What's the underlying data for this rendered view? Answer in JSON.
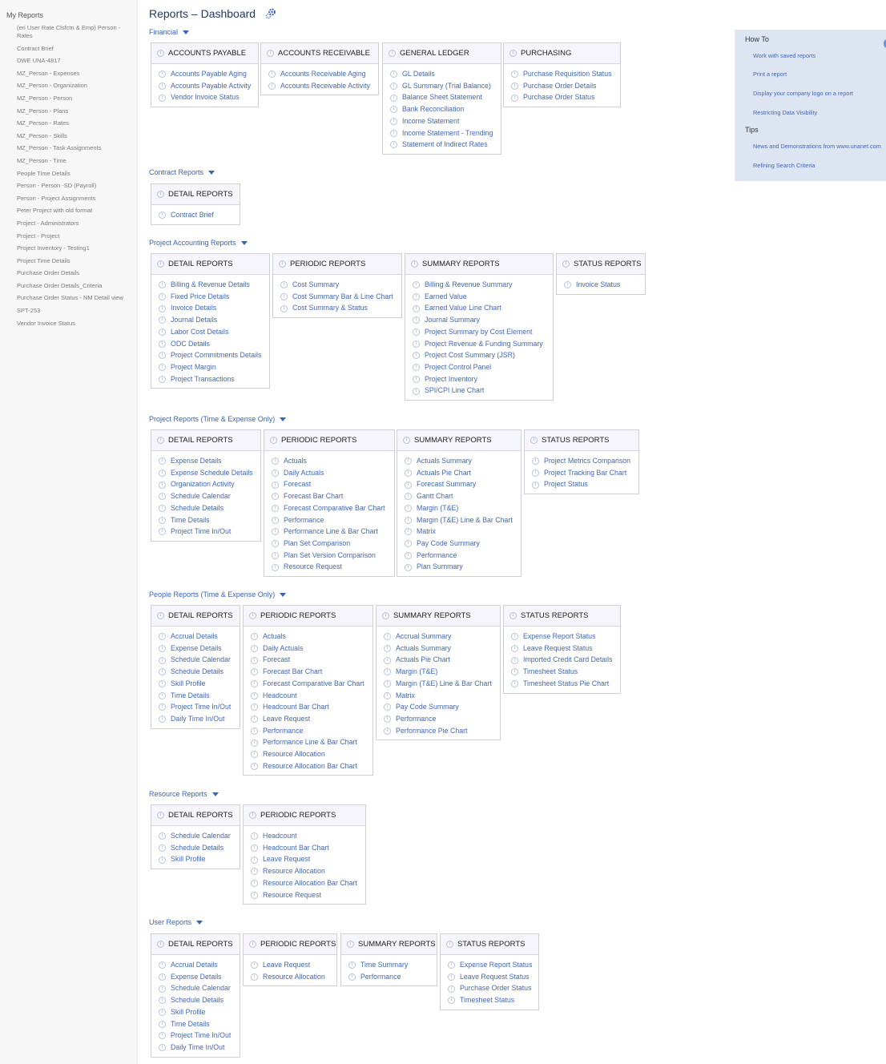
{
  "sidebar": {
    "title": "My Reports",
    "items": [
      "(eri User Rate Clsfctn & Emp) Person - Rates",
      "Contract Brief",
      "DWE UNA-4817",
      "MZ_Person - Expenses",
      "MZ_Person - Organization",
      "MZ_Person - Person",
      "MZ_Person - Plans",
      "MZ_Person - Rates",
      "MZ_Person - Skills",
      "MZ_Person - Task Assignments",
      "MZ_Person - Time",
      "People Time Details",
      "Person - Person -SD (Payroll)",
      "Person - Project Assignments",
      "Peter Project with old format",
      "Project - Administrators",
      "Project - Project",
      "Project Inventory - Testing1",
      "Project Time Details",
      "Purchase Order Details",
      "Purchase Order Details_Criteria",
      "Purchase Order Status - NM Detail view",
      "SPT-253",
      "Vendor Invoice Status"
    ]
  },
  "page_title": "Reports – Dashboard",
  "help": {
    "how_to_title": "How To",
    "how_to_links": [
      "Work with saved reports",
      "Print a report",
      "Display your company logo on a report",
      "Restricting Data Visibility"
    ],
    "tips_title": "Tips",
    "tips_links": [
      "News and Demonstrations from www.unanet.com",
      "Refining Search Criteria"
    ]
  },
  "sections": [
    {
      "title": "Financial",
      "boxes": [
        {
          "title": "ACCOUNTS PAYABLE",
          "items": [
            "Accounts Payable Aging",
            "Accounts Payable Activity",
            "Vendor Invoice Status"
          ]
        },
        {
          "title": "ACCOUNTS RECEIVABLE",
          "items": [
            "Accounts Receivable Aging",
            "Accounts Receivable Activity"
          ]
        },
        {
          "title": "GENERAL LEDGER",
          "items": [
            "GL Details",
            "GL Summary (Trial Balance)",
            "Balance Sheet Statement",
            "Bank Reconciliation",
            "Income Statement",
            "Income Statement - Trending",
            "Statement of Indirect Rates"
          ]
        },
        {
          "title": "PURCHASING",
          "items": [
            "Purchase Requisition Status",
            "Purchase Order Details",
            "Purchase Order Status"
          ]
        }
      ]
    },
    {
      "title": "Contract Reports",
      "boxes": [
        {
          "title": "DETAIL REPORTS",
          "items": [
            "Contract Brief"
          ]
        }
      ]
    },
    {
      "title": "Project Accounting Reports",
      "boxes": [
        {
          "title": "DETAIL REPORTS",
          "items": [
            "Billing & Revenue Details",
            "Fixed Price Details",
            "Invoice Details",
            "Journal Details",
            "Labor Cost Details",
            "ODC Details",
            "Project Commitments Details",
            "Project Margin",
            "Project Transactions"
          ]
        },
        {
          "title": "PERIODIC REPORTS",
          "items": [
            "Cost Summary",
            "Cost Summary Bar & Line Chart",
            "Cost Summary & Status"
          ]
        },
        {
          "title": "SUMMARY REPORTS",
          "items": [
            "Billing & Revenue Summary",
            "Earned Value",
            "Earned Value Line Chart",
            "Journal Summary",
            "Project Summary by Cost Element",
            "Project Revenue & Funding Summary",
            "Project Cost Summary (JSR)",
            "Project Control Panel",
            "Project Inventory",
            "SPI/CPI Line Chart"
          ]
        },
        {
          "title": "STATUS REPORTS",
          "items": [
            "Invoice Status"
          ]
        }
      ]
    },
    {
      "title": "Project Reports (Time & Expense Only)",
      "boxes": [
        {
          "title": "DETAIL REPORTS",
          "items": [
            "Expense Details",
            "Expense Schedule Details",
            "Organization Activity",
            "Schedule Calendar",
            "Schedule Details",
            "Time Details",
            "Project Time In/Out"
          ]
        },
        {
          "title": "PERIODIC REPORTS",
          "items": [
            "Actuals",
            "Daily Actuals",
            "Forecast",
            "Forecast Bar Chart",
            "Forecast Comparative Bar Chart",
            "Performance",
            "Performance Line & Bar Chart",
            "Plan Set Comparison",
            "Plan Set Version Comparison",
            "Resource Request"
          ]
        },
        {
          "title": "SUMMARY REPORTS",
          "items": [
            "Actuals Summary",
            "Actuals Pie Chart",
            "Forecast Summary",
            "Gantt Chart",
            "Margin (T&E)",
            "Margin (T&E) Line & Bar Chart",
            "Matrix",
            "Pay Code Summary",
            "Performance",
            "Plan Summary"
          ]
        },
        {
          "title": "STATUS REPORTS",
          "items": [
            "Project Metrics Comparison",
            "Project Tracking Bar Chart",
            "Project Status"
          ]
        }
      ]
    },
    {
      "title": "People Reports (Time & Expense Only)",
      "boxes": [
        {
          "title": "DETAIL REPORTS",
          "items": [
            "Accrual Details",
            "Expense Details",
            "Schedule Calendar",
            "Schedule Details",
            "Skill Profile",
            "Time Details",
            "Project Time In/Out",
            "Daily Time In/Out"
          ]
        },
        {
          "title": "PERIODIC REPORTS",
          "items": [
            "Actuals",
            "Daily Actuals",
            "Forecast",
            "Forecast Bar Chart",
            "Forecast Comparative Bar Chart",
            "Headcount",
            "Headcount Bar Chart",
            "Leave Request",
            "Performance",
            "Performance Line & Bar Chart",
            "Resource Allocation",
            "Resource Allocation Bar Chart"
          ]
        },
        {
          "title": "SUMMARY REPORTS",
          "items": [
            "Accrual Summary",
            "Actuals Summary",
            "Actuals Pie Chart",
            "Margin (T&E)",
            "Margin (T&E) Line & Bar Chart",
            "Matrix",
            "Pay Code Summary",
            "Performance",
            "Performance Pie Chart"
          ]
        },
        {
          "title": "STATUS REPORTS",
          "items": [
            "Expense Report Status",
            "Leave Request Status",
            "Imported Credit Card Details",
            "Timesheet Status",
            "Timesheet Status Pie Chart"
          ]
        }
      ]
    },
    {
      "title": "Resource Reports",
      "boxes": [
        {
          "title": "DETAIL REPORTS",
          "items": [
            "Schedule Calendar",
            "Schedule Details",
            "Skill Profile"
          ]
        },
        {
          "title": "PERIODIC REPORTS",
          "items": [
            "Headcount",
            "Headcount Bar Chart",
            "Leave Request",
            "Resource Allocation",
            "Resource Allocation Bar Chart",
            "Resource Request"
          ]
        }
      ]
    },
    {
      "title": "User Reports",
      "boxes": [
        {
          "title": "DETAIL REPORTS",
          "items": [
            "Accrual Details",
            "Expense Details",
            "Schedule Calendar",
            "Schedule Details",
            "Skill Profile",
            "Time Details",
            "Project Time In/Out",
            "Daily Time In/Out"
          ]
        },
        {
          "title": "PERIODIC REPORTS",
          "items": [
            "Leave Request",
            "Resource Allocation"
          ]
        },
        {
          "title": "SUMMARY REPORTS",
          "items": [
            "Time Summary",
            "Performance"
          ]
        },
        {
          "title": "STATUS REPORTS",
          "items": [
            "Expense Report Status",
            "Leave Request Status",
            "Purchase Order Status",
            "Timesheet Status"
          ]
        }
      ]
    }
  ]
}
